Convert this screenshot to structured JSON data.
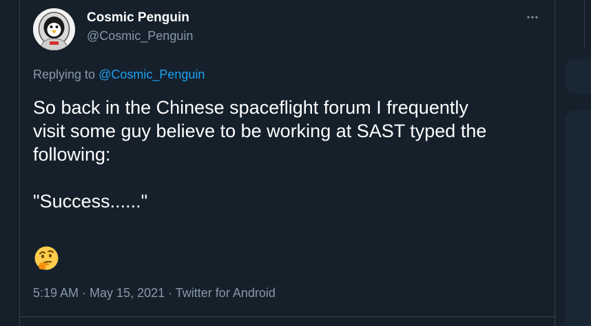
{
  "author": {
    "display_name": "Cosmic Penguin",
    "handle": "@Cosmic_Penguin"
  },
  "more_icon": "more-horizontal-icon",
  "reply": {
    "prefix": "Replying to",
    "mention": "@Cosmic_Penguin"
  },
  "tweet": {
    "text": "So back in the Chinese spaceflight forum I frequently\nvisit some guy believe to be working at SAST typed the\nfollowing:\n\n\"Success......\"",
    "emoji": "thinking-face-emoji"
  },
  "meta": {
    "time": "5:19 AM",
    "date": "May 15, 2021",
    "source": "Twitter for Android",
    "separator": " · "
  },
  "colors": {
    "background": "#15202b",
    "text": "#ffffff",
    "secondary": "#8899a6",
    "accent": "#1da1f2"
  }
}
